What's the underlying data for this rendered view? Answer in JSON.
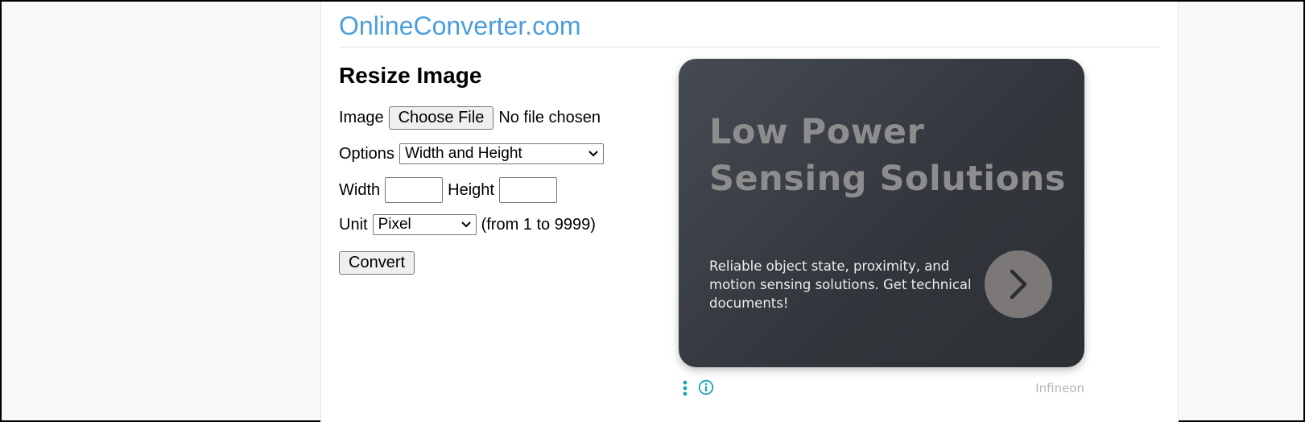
{
  "header": {
    "site_title": "OnlineConverter.com"
  },
  "form": {
    "heading": "Resize Image",
    "image_label": "Image",
    "file_button_label": "Choose File",
    "file_status": "No file chosen",
    "options_label": "Options",
    "options_selected": "Width and Height",
    "width_label": "Width",
    "width_value": "",
    "height_label": "Height",
    "height_value": "",
    "unit_label": "Unit",
    "unit_selected": "Pixel",
    "range_note": "(from 1 to 9999)",
    "convert_label": "Convert"
  },
  "ad": {
    "headline_line1": "Low Power",
    "headline_line2": "Sensing Solutions",
    "body": "Reliable object state, proximity, and motion sensing solutions. Get technical documents!",
    "advertiser": "Infineon",
    "arrow_icon": "chevron-right-icon",
    "menu_icon": "vertical-dots-icon",
    "info_icon": "info-icon"
  },
  "colors": {
    "title_blue": "#4a9edb",
    "ad_icon_teal": "#1aa3b8",
    "ad_card_dark": "#33373d"
  }
}
